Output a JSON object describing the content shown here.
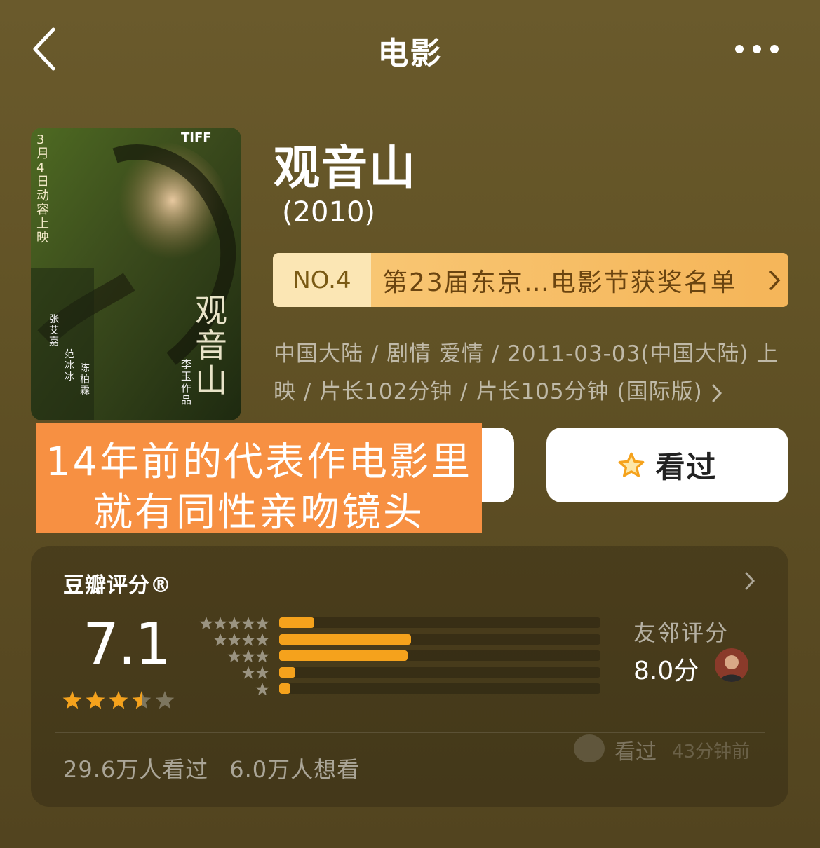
{
  "nav": {
    "title": "电影"
  },
  "poster": {
    "release_note": "3月4日动容上映",
    "festival_logo": "TIFF",
    "title_art": "观音山",
    "cast": [
      "张艾嘉",
      "范冰冰",
      "陈柏霖"
    ],
    "director_credit": "李玉作品"
  },
  "movie": {
    "title": "观音山",
    "year": "(2010)"
  },
  "ranking": {
    "no": "NO.4",
    "text": "第23届东京…电影节获奖名单"
  },
  "meta": {
    "line1": "中国大陆 / 剧情 爱情 / 2011-03-03(中国大陆) 上",
    "line2": "映 / 片长102分钟 / 片长105分钟 (国际版)"
  },
  "buttons": {
    "seen_label": "看过"
  },
  "overlay_caption": {
    "line1": "14年前的代表作电影里",
    "line2": "就有同性亲吻镜头"
  },
  "rating": {
    "title": "豆瓣评分®",
    "score": "7.1",
    "score_stars": 3.5,
    "distribution": [
      {
        "stars": 5,
        "fraction": 0.11
      },
      {
        "stars": 4,
        "fraction": 0.41
      },
      {
        "stars": 3,
        "fraction": 0.4
      },
      {
        "stars": 2,
        "fraction": 0.05
      },
      {
        "stars": 1,
        "fraction": 0.035
      }
    ],
    "friend_label": "友邻评分",
    "friend_score": "8.0分",
    "activity_action": "看过",
    "activity_time": "43分钟前",
    "seen_count": "29.6万人看过",
    "want_count": "6.0万人想看"
  },
  "colors": {
    "bar": "#f5a21c",
    "star": "#f5a21c",
    "caption_bg": "#f79042",
    "rank_bg": "#f5b65a"
  }
}
